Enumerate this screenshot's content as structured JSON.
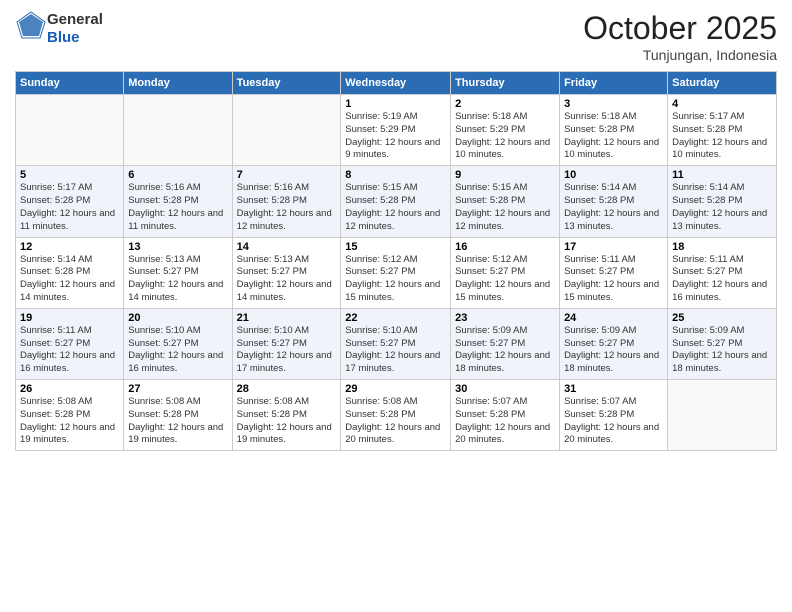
{
  "header": {
    "logo": {
      "general": "General",
      "blue": "Blue"
    },
    "title": "October 2025",
    "location": "Tunjungan, Indonesia"
  },
  "weekdays": [
    "Sunday",
    "Monday",
    "Tuesday",
    "Wednesday",
    "Thursday",
    "Friday",
    "Saturday"
  ],
  "weeks": [
    [
      {
        "day": "",
        "info": ""
      },
      {
        "day": "",
        "info": ""
      },
      {
        "day": "",
        "info": ""
      },
      {
        "day": "1",
        "info": "Sunrise: 5:19 AM\nSunset: 5:29 PM\nDaylight: 12 hours and 9 minutes."
      },
      {
        "day": "2",
        "info": "Sunrise: 5:18 AM\nSunset: 5:29 PM\nDaylight: 12 hours and 10 minutes."
      },
      {
        "day": "3",
        "info": "Sunrise: 5:18 AM\nSunset: 5:28 PM\nDaylight: 12 hours and 10 minutes."
      },
      {
        "day": "4",
        "info": "Sunrise: 5:17 AM\nSunset: 5:28 PM\nDaylight: 12 hours and 10 minutes."
      }
    ],
    [
      {
        "day": "5",
        "info": "Sunrise: 5:17 AM\nSunset: 5:28 PM\nDaylight: 12 hours and 11 minutes."
      },
      {
        "day": "6",
        "info": "Sunrise: 5:16 AM\nSunset: 5:28 PM\nDaylight: 12 hours and 11 minutes."
      },
      {
        "day": "7",
        "info": "Sunrise: 5:16 AM\nSunset: 5:28 PM\nDaylight: 12 hours and 12 minutes."
      },
      {
        "day": "8",
        "info": "Sunrise: 5:15 AM\nSunset: 5:28 PM\nDaylight: 12 hours and 12 minutes."
      },
      {
        "day": "9",
        "info": "Sunrise: 5:15 AM\nSunset: 5:28 PM\nDaylight: 12 hours and 12 minutes."
      },
      {
        "day": "10",
        "info": "Sunrise: 5:14 AM\nSunset: 5:28 PM\nDaylight: 12 hours and 13 minutes."
      },
      {
        "day": "11",
        "info": "Sunrise: 5:14 AM\nSunset: 5:28 PM\nDaylight: 12 hours and 13 minutes."
      }
    ],
    [
      {
        "day": "12",
        "info": "Sunrise: 5:14 AM\nSunset: 5:28 PM\nDaylight: 12 hours and 14 minutes."
      },
      {
        "day": "13",
        "info": "Sunrise: 5:13 AM\nSunset: 5:27 PM\nDaylight: 12 hours and 14 minutes."
      },
      {
        "day": "14",
        "info": "Sunrise: 5:13 AM\nSunset: 5:27 PM\nDaylight: 12 hours and 14 minutes."
      },
      {
        "day": "15",
        "info": "Sunrise: 5:12 AM\nSunset: 5:27 PM\nDaylight: 12 hours and 15 minutes."
      },
      {
        "day": "16",
        "info": "Sunrise: 5:12 AM\nSunset: 5:27 PM\nDaylight: 12 hours and 15 minutes."
      },
      {
        "day": "17",
        "info": "Sunrise: 5:11 AM\nSunset: 5:27 PM\nDaylight: 12 hours and 15 minutes."
      },
      {
        "day": "18",
        "info": "Sunrise: 5:11 AM\nSunset: 5:27 PM\nDaylight: 12 hours and 16 minutes."
      }
    ],
    [
      {
        "day": "19",
        "info": "Sunrise: 5:11 AM\nSunset: 5:27 PM\nDaylight: 12 hours and 16 minutes."
      },
      {
        "day": "20",
        "info": "Sunrise: 5:10 AM\nSunset: 5:27 PM\nDaylight: 12 hours and 16 minutes."
      },
      {
        "day": "21",
        "info": "Sunrise: 5:10 AM\nSunset: 5:27 PM\nDaylight: 12 hours and 17 minutes."
      },
      {
        "day": "22",
        "info": "Sunrise: 5:10 AM\nSunset: 5:27 PM\nDaylight: 12 hours and 17 minutes."
      },
      {
        "day": "23",
        "info": "Sunrise: 5:09 AM\nSunset: 5:27 PM\nDaylight: 12 hours and 18 minutes."
      },
      {
        "day": "24",
        "info": "Sunrise: 5:09 AM\nSunset: 5:27 PM\nDaylight: 12 hours and 18 minutes."
      },
      {
        "day": "25",
        "info": "Sunrise: 5:09 AM\nSunset: 5:27 PM\nDaylight: 12 hours and 18 minutes."
      }
    ],
    [
      {
        "day": "26",
        "info": "Sunrise: 5:08 AM\nSunset: 5:28 PM\nDaylight: 12 hours and 19 minutes."
      },
      {
        "day": "27",
        "info": "Sunrise: 5:08 AM\nSunset: 5:28 PM\nDaylight: 12 hours and 19 minutes."
      },
      {
        "day": "28",
        "info": "Sunrise: 5:08 AM\nSunset: 5:28 PM\nDaylight: 12 hours and 19 minutes."
      },
      {
        "day": "29",
        "info": "Sunrise: 5:08 AM\nSunset: 5:28 PM\nDaylight: 12 hours and 20 minutes."
      },
      {
        "day": "30",
        "info": "Sunrise: 5:07 AM\nSunset: 5:28 PM\nDaylight: 12 hours and 20 minutes."
      },
      {
        "day": "31",
        "info": "Sunrise: 5:07 AM\nSunset: 5:28 PM\nDaylight: 12 hours and 20 minutes."
      },
      {
        "day": "",
        "info": ""
      }
    ]
  ]
}
